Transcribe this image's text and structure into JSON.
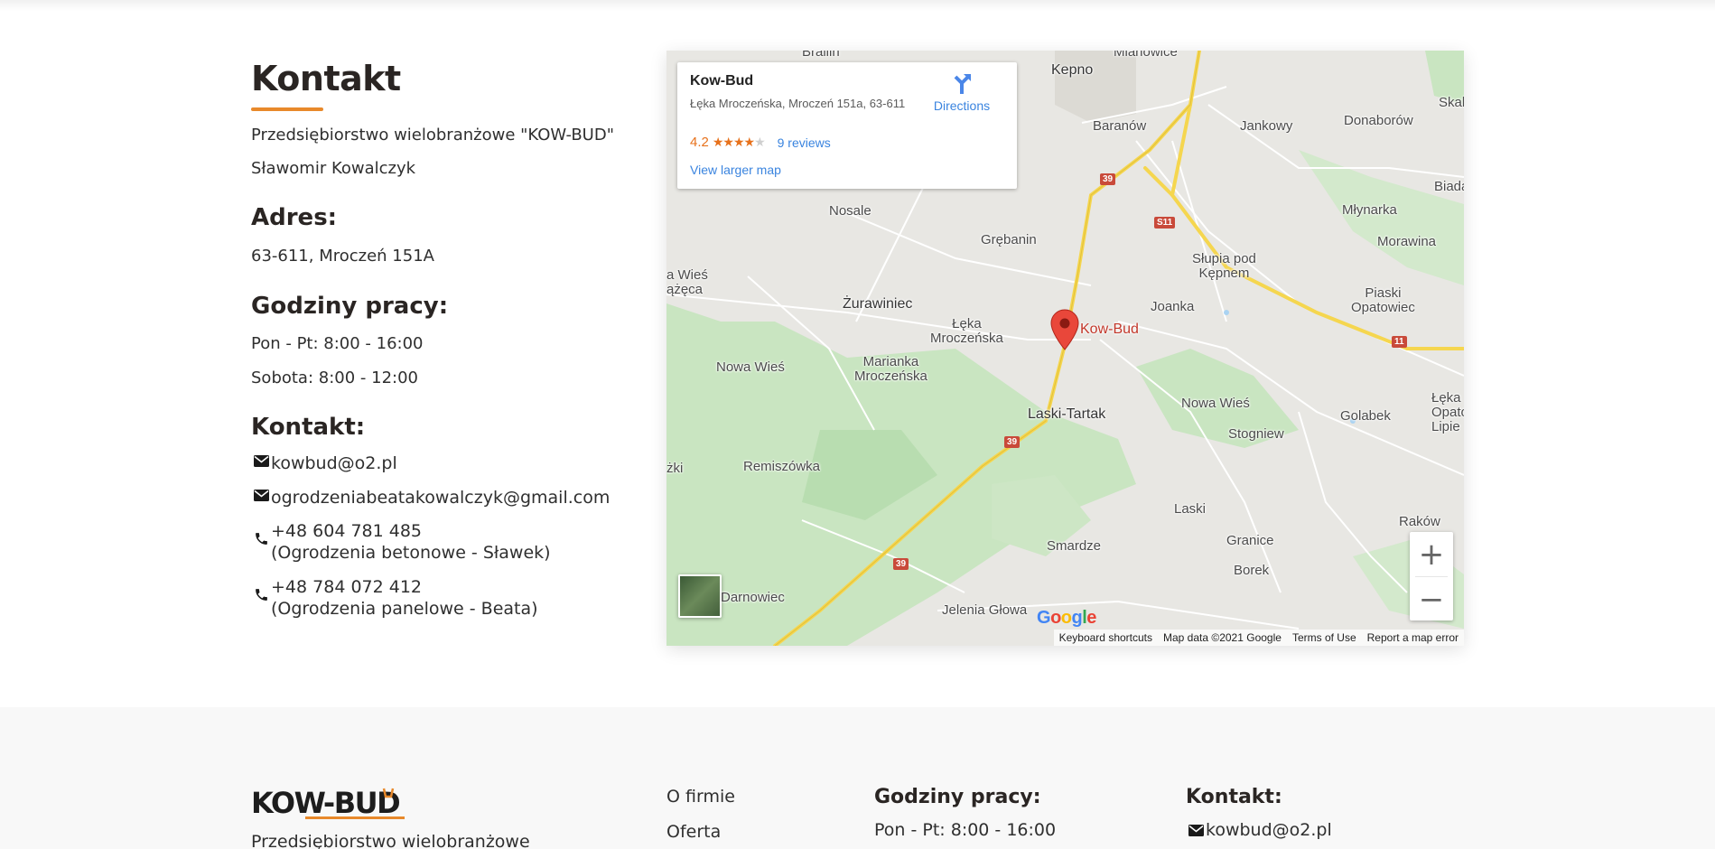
{
  "contact": {
    "title": "Kontakt",
    "company": "Przedsiębiorstwo wielobranżowe \"KOW-BUD\"",
    "owner": "Sławomir Kowalczyk",
    "address_heading": "Adres:",
    "address": "63-611, Mroczeń 151A",
    "hours_heading": "Godziny pracy:",
    "hours_weekdays": "Pon - Pt: 8:00 - 16:00",
    "hours_saturday": "Sobota: 8:00 - 12:00",
    "contact_heading": "Kontakt:",
    "email_1": "kowbud@o2.pl",
    "email_2": "ogrodzeniabeatakowalczyk@gmail.com",
    "phone_1": "+48 604 781 485",
    "phone_1_note": "(Ogrodzenia betonowe - Sławek)",
    "phone_2": "+48 784 072 412",
    "phone_2_note": "(Ogrodzenia panelowe - Beata)"
  },
  "map": {
    "place_name": "Kow-Bud",
    "place_address": "Łęka Mroczeńska, Mroczeń 151a, 63-611",
    "rating": "4.2",
    "stars_full": 4,
    "reviews": "9 reviews",
    "directions": "Directions",
    "view_larger": "View larger map",
    "pin_label": "Kow-Bud",
    "zoom_in": "+",
    "zoom_out": "−",
    "attribution": {
      "shortcuts": "Keyboard shortcuts",
      "data": "Map data ©2021 Google",
      "terms": "Terms of Use",
      "report": "Report a map error"
    },
    "google": "Google",
    "places": {
      "kepno": "Kepno",
      "baranow": "Baranów",
      "jankowy": "Jankowy",
      "donaborow": "Donaborów",
      "skal": "Skal",
      "biada": "Biada",
      "mlynarka": "Młynarka",
      "morawina": "Morawina",
      "nosale": "Nosale",
      "grebanin": "Grębanin",
      "slupia": "Słupia pod\nKępnem",
      "wies_left": "a Wieś\nążęca",
      "zurawiniec": "Żurawiniec",
      "joanka": "Joanka",
      "piaski": "Piaski\nOpatowiec",
      "leka": "Łęka\nMroczeńska",
      "nowa_wies_l": "Nowa Wieś",
      "marianka": "Marianka\nMroczeńska",
      "laski_tartak": "Laski-Tartak",
      "nowa_wies_r": "Nowa Wieś",
      "golabek": "Golabek",
      "stogniew": "Stogniew",
      "leka_opat": "Łęka\nOpatow\nLipie",
      "zki": "żki",
      "remiszowka": "Remiszówka",
      "laski": "Laski",
      "granice": "Granice",
      "rakow": "Raków",
      "smardze": "Smardze",
      "borek": "Borek",
      "darnowiec": "Darnowiec",
      "jelenia": "Jelenia Głowa",
      "brallin": "Brallin",
      "mianowice": "Mianowice"
    },
    "roads": {
      "r39a": "39",
      "r39b": "39",
      "r39c": "39",
      "s11": "S11",
      "r11": "11"
    }
  },
  "footer": {
    "logo_text": "KOW-BUD",
    "about": "Przedsiębiorstwo wielobranżowe",
    "nav": [
      "O firmie",
      "Oferta"
    ],
    "hours_heading": "Godziny pracy:",
    "hours_weekdays": "Pon - Pt: 8:00 - 16:00",
    "contact_heading": "Kontakt:",
    "email": "kowbud@o2.pl"
  },
  "colors": {
    "accent": "#e8892b",
    "link": "#3a84df",
    "pin": "#d7443a",
    "road_major": "#f4d24b"
  }
}
